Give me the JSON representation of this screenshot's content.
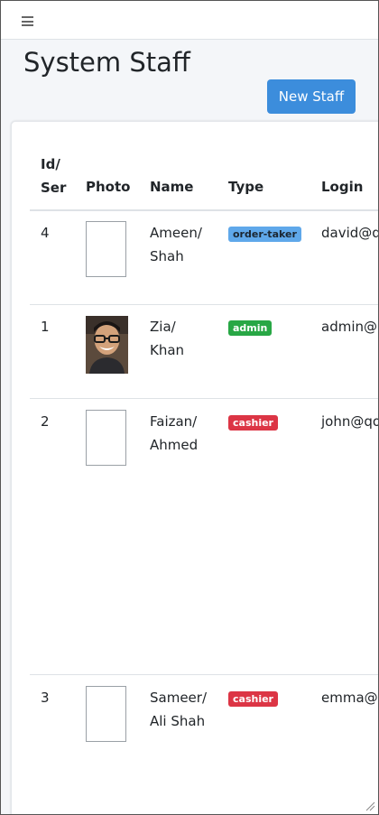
{
  "topbar": {
    "menu_icon": "hamburger-icon"
  },
  "page": {
    "title": "System Staff",
    "new_button_label": "New Staff"
  },
  "colors": {
    "primary": "#3c8ddc",
    "order_taker_badge": "#5fa8ea",
    "admin_badge": "#28a745",
    "cashier_badge": "#dc3545"
  },
  "table": {
    "headers": {
      "id_line1": "Id/",
      "id_line2": "Ser",
      "photo": "Photo",
      "name": "Name",
      "type": "Type",
      "login": "Login"
    },
    "rows": [
      {
        "id": "4",
        "photo": "empty",
        "first_name": "Ameen/",
        "last_name": "Shah",
        "type": "order-taker",
        "login": "david@q"
      },
      {
        "id": "1",
        "photo": "person-photo",
        "first_name": "Zia/",
        "last_name": "Khan",
        "type": "admin",
        "login": "admin@"
      },
      {
        "id": "2",
        "photo": "empty",
        "first_name": "Faizan/",
        "last_name": "Ahmed",
        "type": "cashier",
        "login": "john@qo"
      },
      {
        "id": "3",
        "photo": "empty",
        "first_name": "Sameer/",
        "last_name": "Ali Shah",
        "type": "cashier",
        "login": "emma@"
      }
    ]
  }
}
